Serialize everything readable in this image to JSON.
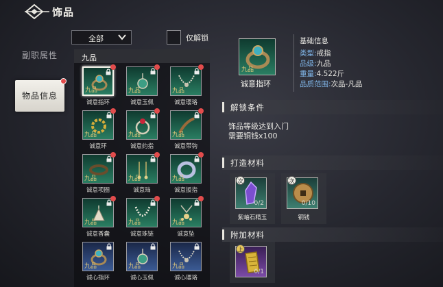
{
  "header": {
    "title": "饰品"
  },
  "tabs": [
    {
      "label": "副职属性"
    },
    {
      "label": "物品信息"
    }
  ],
  "filter": {
    "dropdown_value": "全部",
    "checkbox_label": "仅解锁"
  },
  "list": {
    "section_title": "九品",
    "grade_label": "九品",
    "items": [
      {
        "name": "诚意指环",
        "icon": "ring-icon"
      },
      {
        "name": "诚意玉佩",
        "icon": "jade-pendant-icon"
      },
      {
        "name": "诚意璎珞",
        "icon": "necklace-icon"
      },
      {
        "name": "诚意环",
        "icon": "gold-ring-icon"
      },
      {
        "name": "诚意约指",
        "icon": "ruby-ring-icon"
      },
      {
        "name": "诚意带钩",
        "icon": "belt-hook-icon"
      },
      {
        "name": "诚意项圈",
        "icon": "collar-icon"
      },
      {
        "name": "诚意珰",
        "icon": "earring-icon"
      },
      {
        "name": "诚意扳指",
        "icon": "thumb-ring-icon"
      },
      {
        "name": "诚意香囊",
        "icon": "sachet-icon"
      },
      {
        "name": "诚意珠链",
        "icon": "bead-chain-icon"
      },
      {
        "name": "诚意坠",
        "icon": "pendant-icon"
      },
      {
        "name": "诚心指环",
        "icon": "ring-icon"
      },
      {
        "name": "诚心玉佩",
        "icon": "jade-pendant-icon"
      },
      {
        "name": "诚心璎珞",
        "icon": "necklace-icon"
      }
    ]
  },
  "detail": {
    "name": "诚意指环",
    "grade": "九品",
    "info_title": "基础信息",
    "rows": [
      {
        "key": "类型:",
        "value": "戒指"
      },
      {
        "key": "品级:",
        "value": "九品"
      },
      {
        "key": "重量:",
        "value": "4.522斤"
      },
      {
        "key": "品质范围:",
        "value": "次品-凡品"
      }
    ]
  },
  "unlock": {
    "title": "解锁条件",
    "lines": [
      "饰品等级达到入门",
      "需要铜钱x100"
    ]
  },
  "materials": {
    "title": "打造材料",
    "items": [
      {
        "name": "紫岫石精玉",
        "badge": "次",
        "count": "0/2",
        "icon": "purple-crystal-icon"
      },
      {
        "name": "铜钱",
        "badge": "次",
        "count": "0/10",
        "icon": "copper-coin-icon"
      }
    ]
  },
  "extra": {
    "title": "附加材料",
    "items": [
      {
        "badge": "上",
        "count": "0/1",
        "icon": "silk-scroll-icon"
      }
    ]
  }
}
